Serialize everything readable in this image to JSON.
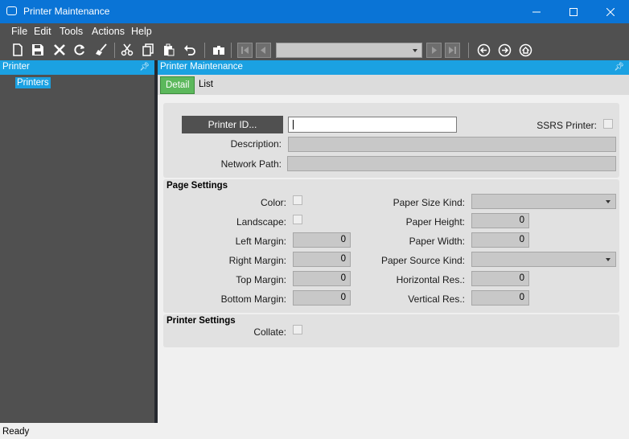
{
  "window": {
    "title": "Printer Maintenance"
  },
  "menu": [
    "File",
    "Edit",
    "Tools",
    "Actions",
    "Help"
  ],
  "left_pane": {
    "header": "Printer",
    "tree_item": "Printers"
  },
  "right_pane": {
    "header": "Printer Maintenance"
  },
  "tabs": [
    "Detail",
    "List"
  ],
  "detail": {
    "printer_id_button": "Printer ID...",
    "printer_id_value": "",
    "ssrs_label": "SSRS Printer:",
    "description_label": "Description:",
    "network_path_label": "Network Path:"
  },
  "page_settings": {
    "title": "Page Settings",
    "color_label": "Color:",
    "landscape_label": "Landscape:",
    "left_margin_label": "Left Margin:",
    "left_margin": "0",
    "right_margin_label": "Right Margin:",
    "right_margin": "0",
    "top_margin_label": "Top Margin:",
    "top_margin": "0",
    "bottom_margin_label": "Bottom Margin:",
    "bottom_margin": "0",
    "paper_size_kind_label": "Paper Size Kind:",
    "paper_height_label": "Paper Height:",
    "paper_height": "0",
    "paper_width_label": "Paper Width:",
    "paper_width": "0",
    "paper_source_kind_label": "Paper Source Kind:",
    "horizontal_res_label": "Horizontal Res.:",
    "horizontal_res": "0",
    "vertical_res_label": "Vertical Res.:",
    "vertical_res": "0"
  },
  "printer_settings": {
    "title": "Printer Settings",
    "collate_label": "Collate:"
  },
  "status": "Ready",
  "colors": {
    "titlebar": "#0a74d6",
    "accent": "#1ba1e2",
    "dark": "#505050",
    "active_tab": "#5cb85c"
  }
}
